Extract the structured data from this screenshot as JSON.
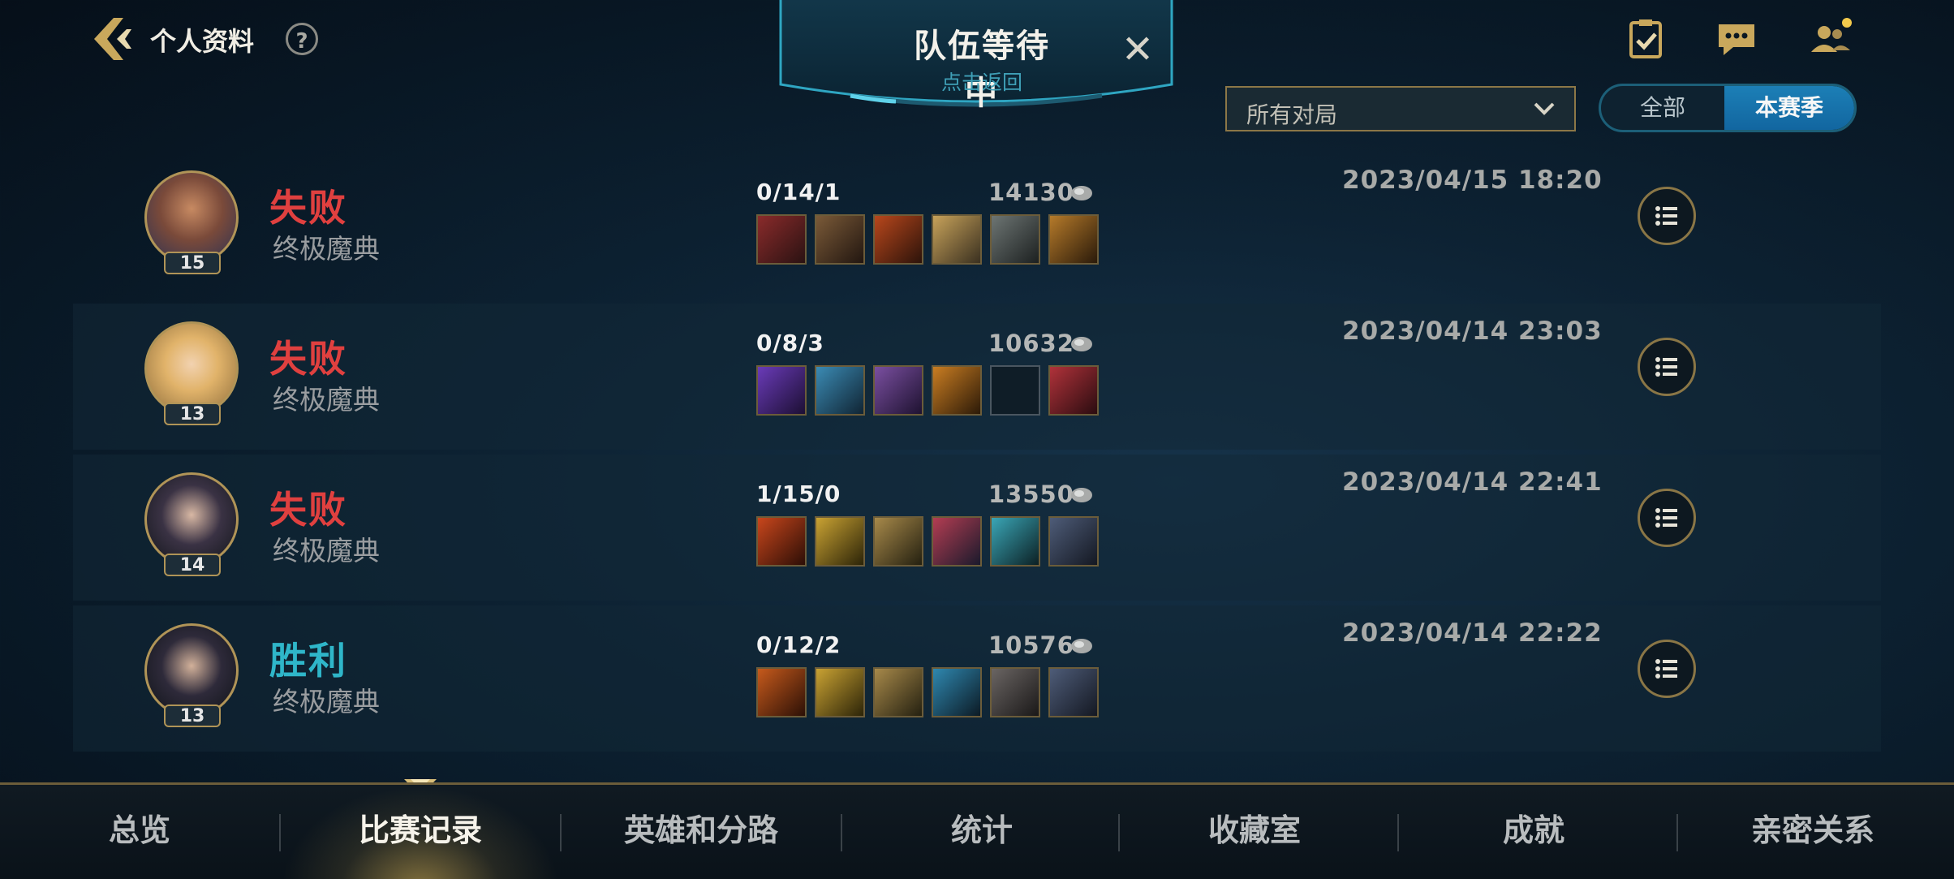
{
  "header": {
    "title": "个人资料",
    "help_label": "?"
  },
  "queue": {
    "title": "队伍等待中",
    "subtitle": "点击返回",
    "close_label": "✕"
  },
  "filter": {
    "selected": "所有对局"
  },
  "season_toggle": {
    "options": [
      "全部",
      "本赛季"
    ],
    "selected": "本赛季"
  },
  "matches": [
    {
      "result": "失败",
      "result_color": "#e0403f",
      "mode": "终极魔典",
      "level": "15",
      "kda": "0/14/1",
      "gold": "14130",
      "datetime": "2023/04/15 18:20",
      "items": [
        "#8a2b2b",
        "#7a5a38",
        "#b8471c",
        "#c7a25a",
        "#6d7573",
        "#b57a2a"
      ]
    },
    {
      "result": "失败",
      "result_color": "#e0403f",
      "mode": "终极魔典",
      "level": "13",
      "kda": "0/8/3",
      "gold": "10632",
      "datetime": "2023/04/14 23:03",
      "items": [
        "#6a3bb8",
        "#3b8bb4",
        "#7a4fa0",
        "#c97d22",
        "empty",
        "#b0323a"
      ]
    },
    {
      "result": "失败",
      "result_color": "#e0403f",
      "mode": "终极魔典",
      "level": "14",
      "kda": "1/15/0",
      "gold": "13550",
      "datetime": "2023/04/14 22:41",
      "items": [
        "#c8461c",
        "#c9a233",
        "#a7894a",
        "#b33d52",
        "#3aa6b6",
        "#4e5c78"
      ]
    },
    {
      "result": "胜利",
      "result_color": "#2fb6c9",
      "mode": "终极魔典",
      "level": "13",
      "kda": "0/12/2",
      "gold": "10576",
      "datetime": "2023/04/14 22:22",
      "items": [
        "#c65a1c",
        "#c9a233",
        "#a7894a",
        "#2f88b0",
        "#6a6563",
        "#4e5c78"
      ]
    }
  ],
  "nav": {
    "tabs": [
      "总览",
      "比赛记录",
      "英雄和分路",
      "统计",
      "收藏室",
      "成就",
      "亲密关系"
    ],
    "active": "比赛记录"
  },
  "colors": {
    "gold_accent": "#b09457",
    "loss": "#e0403f",
    "win": "#2fb6c9",
    "toggle_active": "#1a78b0"
  },
  "icons": [
    "back-arrow-icon",
    "help-icon",
    "close-icon",
    "tasks-icon",
    "chat-icon",
    "friends-icon",
    "chevron-down-icon",
    "gold-icon",
    "list-icon"
  ]
}
